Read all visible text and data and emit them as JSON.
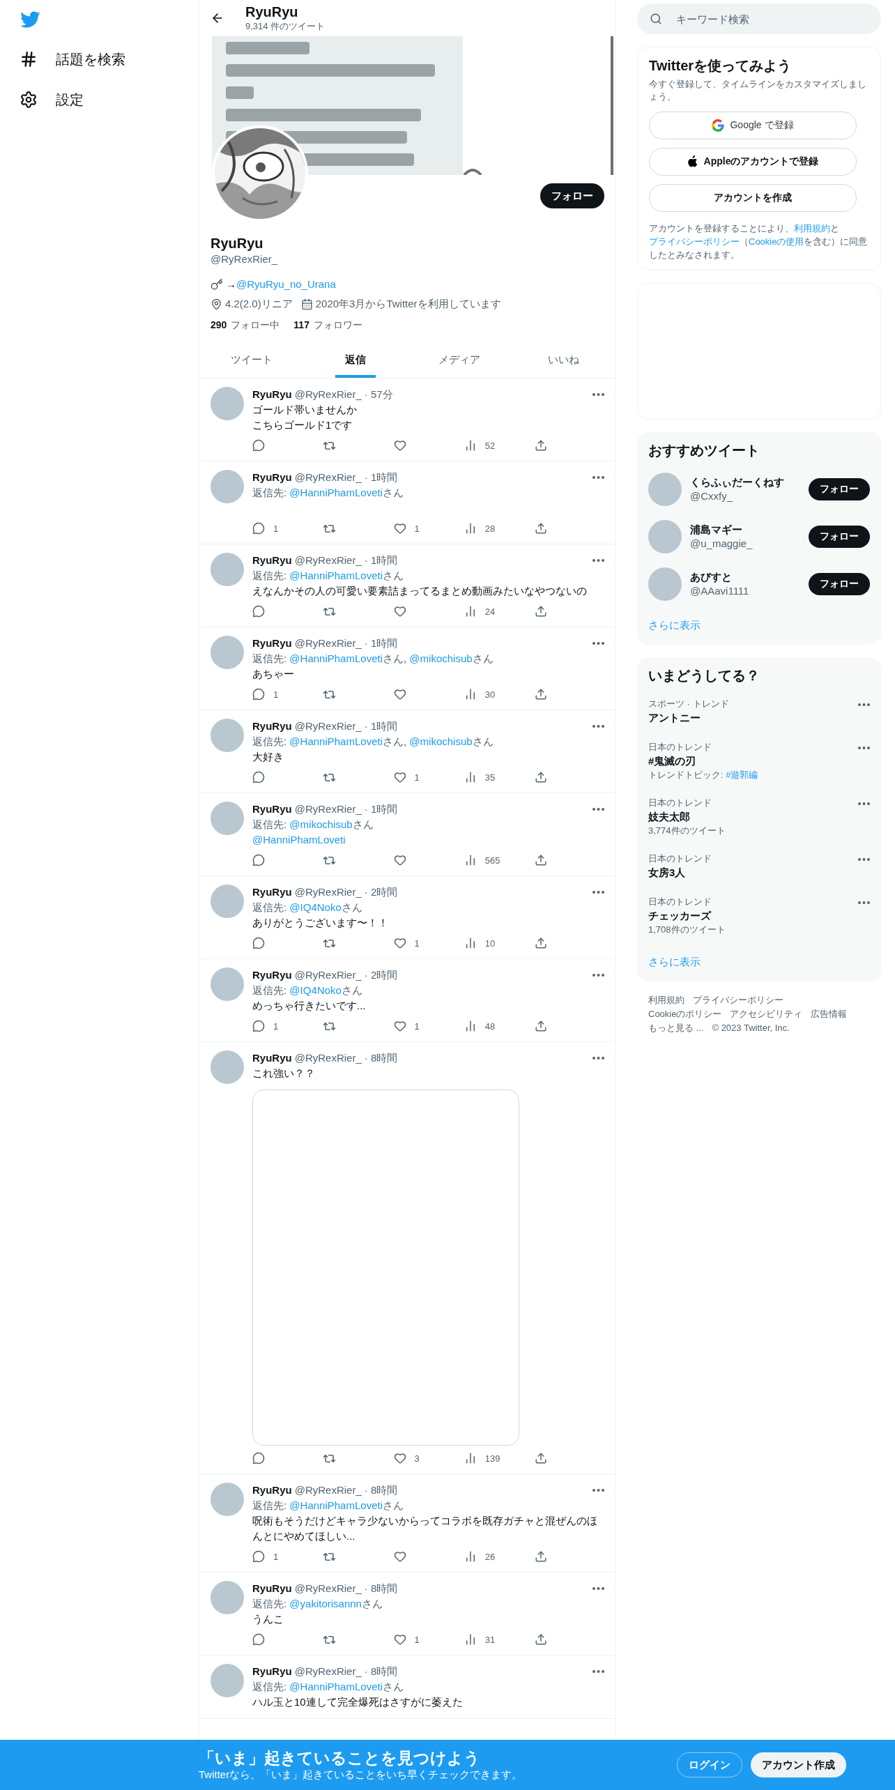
{
  "nav": {
    "items": [
      {
        "kind": "explore",
        "label": "話題を検索"
      },
      {
        "kind": "settings",
        "label": "設定"
      }
    ]
  },
  "header": {
    "title": "RyuRyu",
    "subtitle": "9,314 件のツイート"
  },
  "profile": {
    "name": "RyuRyu",
    "handle": "@RyRexRier_",
    "follow_button": "フォロー",
    "bio": [
      {
        "text": "→"
      },
      {
        "link": "@RyuRyu_no_Urana"
      }
    ],
    "location": "4.2(2.0)リニア",
    "joined": "2020年3月からTwitterを利用しています",
    "following_count": "290",
    "following_label": "フォロー中",
    "followers_count": "117",
    "followers_label": "フォロワー"
  },
  "tabs": [
    {
      "label": "ツイート",
      "selected": false
    },
    {
      "label": "返信",
      "selected": true
    },
    {
      "label": "メディア",
      "selected": false
    },
    {
      "label": "いいね",
      "selected": false
    }
  ],
  "tweets": [
    {
      "name": "RyuRyu",
      "handle": "@RyRexRier_",
      "time": "· 57分",
      "body": [
        {
          "text": "ゴールド帯いませんか"
        },
        {
          "text": "こちらゴールド1です"
        }
      ],
      "views": "52",
      "actions_shown": true
    },
    {
      "name": "RyuRyu",
      "handle": "@RyRexRier_",
      "time": "· 1時間",
      "reply": [
        {
          "text": "返信先: "
        },
        {
          "link": "@HanniPhamLoveti"
        },
        {
          "text": "さん"
        }
      ],
      "replies": "1",
      "likes": "1",
      "views": "28",
      "actions_shown": true
    },
    {
      "name": "RyuRyu",
      "handle": "@RyRexRier_",
      "time": "· 1時間",
      "reply": [
        {
          "text": "返信先: "
        },
        {
          "link": "@HanniPhamLoveti"
        },
        {
          "text": "さん"
        }
      ],
      "body": [
        {
          "text": "えなんかその人の可愛い要素詰まってるまとめ動画みたいなやつないの"
        }
      ],
      "views": "24",
      "actions_shown": true
    },
    {
      "name": "RyuRyu",
      "handle": "@RyRexRier_",
      "time": "· 1時間",
      "reply": [
        {
          "text": "返信先: "
        },
        {
          "link": "@HanniPhamLoveti"
        },
        {
          "text": "さん, "
        },
        {
          "link": "@mikochisub"
        },
        {
          "text": "さん"
        }
      ],
      "body": [
        {
          "text": "あちゃー"
        }
      ],
      "replies": "1",
      "views": "30",
      "actions_shown": true
    },
    {
      "name": "RyuRyu",
      "handle": "@RyRexRier_",
      "time": "· 1時間",
      "reply": [
        {
          "text": "返信先: "
        },
        {
          "link": "@HanniPhamLoveti"
        },
        {
          "text": "さん, "
        },
        {
          "link": "@mikochisub"
        },
        {
          "text": "さん"
        }
      ],
      "body": [
        {
          "text": "大好き"
        }
      ],
      "likes": "1",
      "views": "35",
      "actions_shown": true
    },
    {
      "name": "RyuRyu",
      "handle": "@RyRexRier_",
      "time": "· 1時間",
      "reply": [
        {
          "text": "返信先: "
        },
        {
          "link": "@mikochisub"
        },
        {
          "text": "さん"
        }
      ],
      "body": [
        {
          "link": "@HanniPhamLoveti"
        }
      ],
      "views": "565",
      "actions_shown": true
    },
    {
      "name": "RyuRyu",
      "handle": "@RyRexRier_",
      "time": "· 2時間",
      "reply": [
        {
          "text": "返信先: "
        },
        {
          "link": "@IQ4Noko"
        },
        {
          "text": "さん"
        }
      ],
      "body": [
        {
          "text": "ありがとうございます〜！！"
        }
      ],
      "likes": "1",
      "views": "10",
      "actions_shown": true
    },
    {
      "name": "RyuRyu",
      "handle": "@RyRexRier_",
      "time": "· 2時間",
      "reply": [
        {
          "text": "返信先: "
        },
        {
          "link": "@IQ4Noko"
        },
        {
          "text": "さん"
        }
      ],
      "body": [
        {
          "text": "めっちゃ行きたいです..."
        }
      ],
      "replies": "1",
      "likes": "1",
      "views": "48",
      "actions_shown": true
    },
    {
      "name": "RyuRyu",
      "handle": "@RyRexRier_",
      "time": "· 8時間",
      "body": [
        {
          "text": "これ強い？？"
        }
      ],
      "media": {
        "kind": "empty"
      },
      "likes": "3",
      "views": "139",
      "actions_shown": true
    },
    {
      "name": "RyuRyu",
      "handle": "@RyRexRier_",
      "time": "· 8時間",
      "reply": [
        {
          "text": "返信先: "
        },
        {
          "link": "@HanniPhamLoveti"
        },
        {
          "text": "さん"
        }
      ],
      "body": [
        {
          "text": "呪術もそうだけどキャラ少ないからってコラボを既存ガチャと混ぜんのほんとにやめてほしい..."
        }
      ],
      "replies": "1",
      "views": "26",
      "actions_shown": true
    },
    {
      "name": "RyuRyu",
      "handle": "@RyRexRier_",
      "time": "· 8時間",
      "reply": [
        {
          "text": "返信先: "
        },
        {
          "link": "@yakitorisannn"
        },
        {
          "text": "さん"
        }
      ],
      "body": [
        {
          "text": "うんこ"
        }
      ],
      "likes": "1",
      "views": "31",
      "actions_shown": true
    },
    {
      "name": "RyuRyu",
      "handle": "@RyRexRier_",
      "time": "· 8時間",
      "reply": [
        {
          "text": "返信先: "
        },
        {
          "link": "@HanniPhamLoveti"
        },
        {
          "text": "さん"
        }
      ],
      "body": [
        {
          "text": "ハル玉と10連して完全爆死はさすがに萎えた"
        }
      ],
      "actions_shown": false
    }
  ],
  "search": {
    "placeholder": "キーワード検索"
  },
  "signup": {
    "title": "Twitterを使ってみよう",
    "subtitle": "今すぐ登録して、タイムラインをカスタマイズしましょう。",
    "buttons": [
      {
        "kind": "google",
        "label": "Google で登録"
      },
      {
        "kind": "apple",
        "label": "Appleのアカウントで登録"
      },
      {
        "kind": "create",
        "label": "アカウントを作成"
      }
    ],
    "terms": [
      {
        "text": "アカウントを登録することにより、"
      },
      {
        "link": "利用規約"
      },
      {
        "text": "と"
      },
      {
        "link": "プライバシーポリシー"
      },
      {
        "text": "（"
      },
      {
        "link": "Cookieの使用"
      },
      {
        "text": "を含む）に同意したとみなされます。"
      }
    ]
  },
  "recommended": {
    "title": "おすすめツイート",
    "users": [
      {
        "name": "くらふぃだーくねす",
        "handle": "@Cxxfy_",
        "button": "フォロー"
      },
      {
        "name": "浦島マギー",
        "handle": "@u_maggie_",
        "button": "フォロー"
      },
      {
        "name": "あびすと",
        "handle": "@AAavi1111",
        "button": "フォロー"
      }
    ],
    "more": "さらに表示"
  },
  "trends": {
    "title": "いまどうしてる？",
    "items": [
      {
        "category": "スポーツ · トレンド",
        "title": "アントニー"
      },
      {
        "category": "日本のトレンド",
        "title": "#鬼滅の刃",
        "topic": [
          {
            "text": "トレンドトピック: "
          },
          {
            "link": "#遊郭編"
          }
        ]
      },
      {
        "category": "日本のトレンド",
        "title": "妓夫太郎",
        "count": "3,774件のツイート"
      },
      {
        "category": "日本のトレンド",
        "title": "女房3人"
      },
      {
        "category": "日本のトレンド",
        "title": "チェッカーズ",
        "count": "1,708件のツイート"
      }
    ],
    "more": "さらに表示"
  },
  "footer": {
    "links": [
      "利用規約",
      "プライバシーポリシー",
      "Cookieのポリシー",
      "アクセシビリティ",
      "広告情報",
      "もっと見る ..."
    ],
    "copyright": "© 2023 Twitter, Inc."
  },
  "bottom_bar": {
    "title": "「いま」起きていることを見つけよう",
    "subtitle": "Twitterなら、「いま」起きていることをいち早くチェックできます。",
    "login": "ログイン",
    "signup": "アカウント作成"
  }
}
